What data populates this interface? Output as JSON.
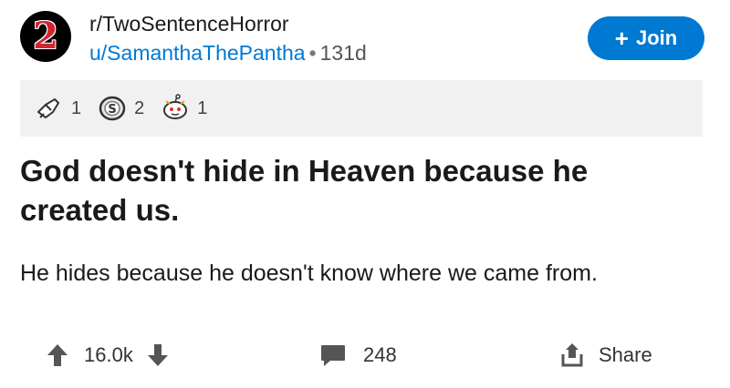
{
  "subreddit": {
    "icon_text": "2",
    "name": "r/TwoSentenceHorror"
  },
  "post_meta": {
    "author": "u/SamanthaThePantha",
    "separator": "•",
    "age": "131d"
  },
  "join_button": {
    "icon": "plus-icon",
    "label": "Join"
  },
  "awards": [
    {
      "icon": "rocket-like-award-icon",
      "count": "1"
    },
    {
      "icon": "silver-award-icon",
      "count": "2"
    },
    {
      "icon": "snoo-award-icon",
      "count": "1"
    }
  ],
  "post": {
    "title": "God doesn't hide in Heaven because he created us.",
    "body": "He hides because he doesn't know where we came from."
  },
  "actions": {
    "score": "16.0k",
    "comments": "248",
    "share_label": "Share"
  },
  "colors": {
    "accent": "#0079d3",
    "award_bar": "#f1f1f1",
    "text": "#1a1a1b"
  }
}
